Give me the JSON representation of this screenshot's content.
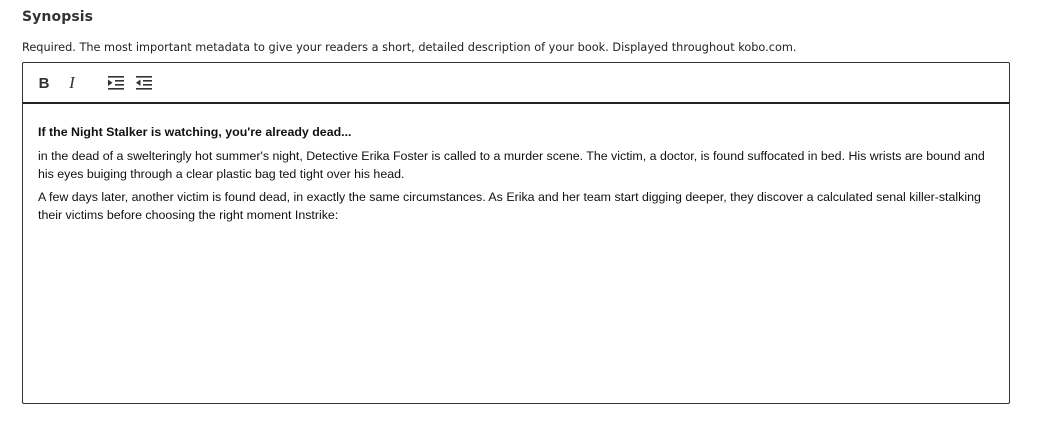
{
  "section": {
    "title": "Synopsis",
    "helper_text": "Required. The most important metadata to give your readers a short, detailed description of your book. Displayed throughout kobo.com."
  },
  "toolbar": {
    "bold_label": "B",
    "italic_label": "I",
    "indent_icon": "indent-icon",
    "outdent_icon": "outdent-icon"
  },
  "editor": {
    "paragraphs": [
      "If the Night Stalker is watching, you're already dead...",
      "in the dead of a swelteringly hot summer's night, Detective Erika Foster is called to a murder scene. The victim, a doctor, is found suffocated in bed. His wrists are bound and his eyes buiging through a clear plastic bag ted tight over his head.",
      "A few days later, another victim is found dead, in exactly the same circumstances. As Erika and her team start digging deeper, they discover a calculated senal killer-stalking their victims before choosing the right moment Instrike:"
    ]
  }
}
